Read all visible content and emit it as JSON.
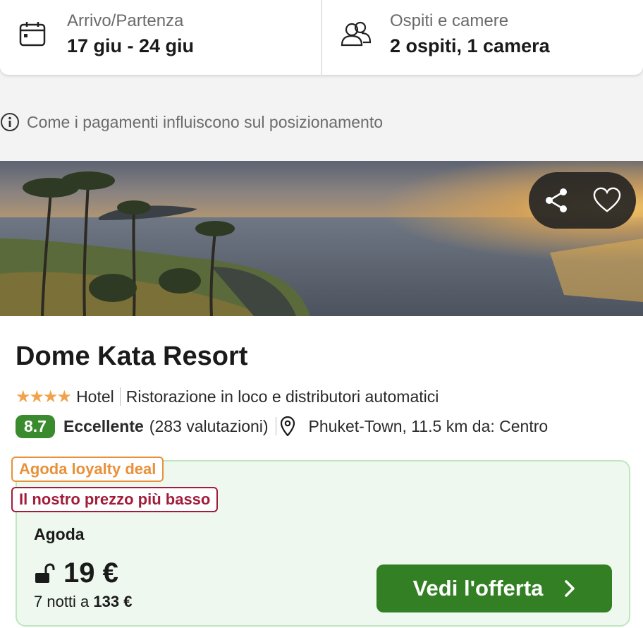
{
  "search": {
    "dates_label": "Arrivo/Partenza",
    "dates_value": "17 giu - 24 giu",
    "guests_label": "Ospiti e camere",
    "guests_value": "2 ospiti, 1 camera"
  },
  "info": {
    "text": "Come i pagamenti influiscono sul posizionamento"
  },
  "hotel": {
    "name": "Dome Kata Resort",
    "stars": "★★★★",
    "type": "Hotel",
    "amenity": "Ristorazione in loco e distributori automatici",
    "score": "8.7",
    "score_word": "Eccellente",
    "reviews": "(283 valutazioni)",
    "location": "Phuket-Town, 11.5 km da: Centro"
  },
  "deal": {
    "tag_loyalty": "Agoda loyalty deal",
    "tag_lowest": "Il nostro prezzo più basso",
    "provider": "Agoda",
    "price": "19 €",
    "total_prefix": "7 notti a",
    "total_amount": "133 €",
    "cta": "Vedi l'offerta"
  },
  "colors": {
    "accent_green": "#338024",
    "score_green": "#3a8a2e",
    "loyalty_orange": "#e8913a",
    "lowest_red": "#a11d3a",
    "star_orange": "#f0a34b"
  },
  "icons": [
    "calendar-icon",
    "guests-icon",
    "info-icon",
    "share-icon",
    "heart-icon",
    "location-pin-icon",
    "unlock-icon",
    "chevron-right-icon"
  ]
}
